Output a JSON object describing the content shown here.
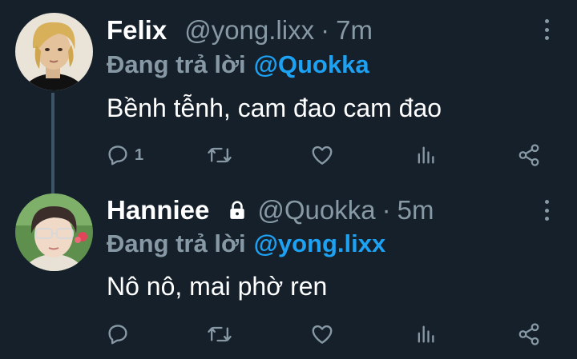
{
  "colors": {
    "background": "#15202b",
    "secondary_text": "#8899a6",
    "accent": "#1da1f2",
    "primary_text": "#ffffff"
  },
  "tweets": [
    {
      "name": "Felix",
      "handle": "@yong.lixx",
      "time": "7m",
      "locked": false,
      "reply_prefix": "Đang trả lời",
      "reply_to": "@Quokka",
      "text": "Bềnh tễnh, cam đao cam đao",
      "reply_count": "1",
      "icons": [
        "reply-icon",
        "retweet-icon",
        "like-icon",
        "stats-icon",
        "share-icon",
        "more-icon"
      ]
    },
    {
      "name": "Hanniee",
      "handle": "@Quokka",
      "time": "5m",
      "locked": true,
      "reply_prefix": "Đang trả lời",
      "reply_to": "@yong.lixx",
      "text": "Nô nô, mai phờ ren",
      "reply_count": "",
      "icons": [
        "lock-icon",
        "reply-icon",
        "retweet-icon",
        "like-icon",
        "stats-icon",
        "share-icon",
        "more-icon"
      ]
    }
  ],
  "separator": "·"
}
